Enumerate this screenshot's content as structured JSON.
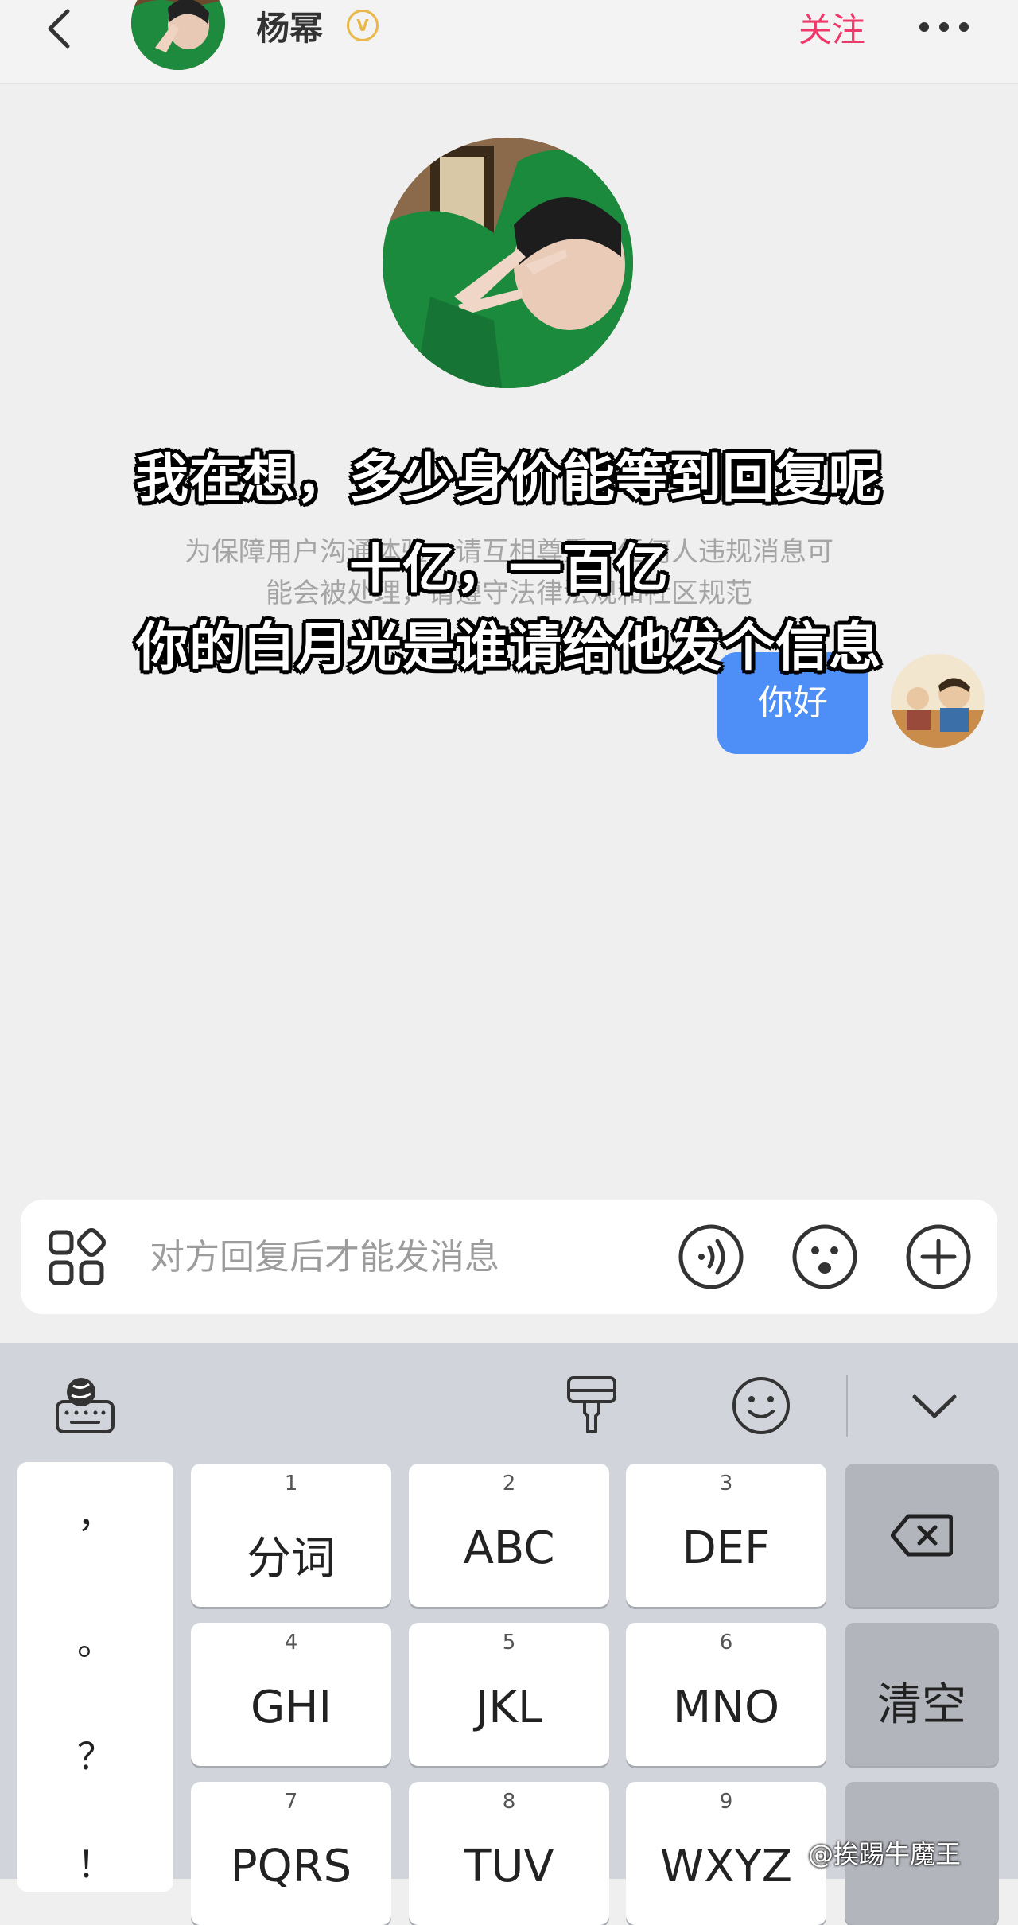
{
  "header": {
    "name": "杨幂",
    "verified_badge": "V",
    "follow_label": "关注",
    "icons": [
      "back-icon",
      "more-icon"
    ]
  },
  "chat": {
    "notice_line1": "为保障用户沟通体验，请互相尊重，任何人违规消息可",
    "notice_line2": "能会被处理，请遵守法律法规和社区规范",
    "my_message": "你好"
  },
  "caption": {
    "line1": "我在想，多少身价能等到回复呢",
    "line2": "十亿，一百亿",
    "line3": "你的白月光是谁请给他发个信息"
  },
  "input_bar": {
    "placeholder": "对方回复后才能发消息",
    "icons": [
      "apps-icon",
      "voice-icon",
      "emoji-icon",
      "plus-icon"
    ]
  },
  "keyboard": {
    "toolbar_icons": [
      "globe-keyboard-icon",
      "brush-icon",
      "smile-icon",
      "chevron-down-icon"
    ],
    "punctuation": [
      "，",
      "。",
      "？",
      "！"
    ],
    "keys": [
      {
        "num": "1",
        "label": "分词"
      },
      {
        "num": "2",
        "label": "ABC"
      },
      {
        "num": "3",
        "label": "DEF"
      },
      {
        "num": "4",
        "label": "GHI"
      },
      {
        "num": "5",
        "label": "JKL"
      },
      {
        "num": "6",
        "label": "MNO"
      },
      {
        "num": "7",
        "label": "PQRS"
      },
      {
        "num": "8",
        "label": "TUV"
      },
      {
        "num": "9",
        "label": "WXYZ"
      }
    ],
    "clear_label": "清空",
    "backspace_icon": "backspace-icon"
  },
  "watermark": "@挨踢牛魔王",
  "colors": {
    "follow": "#f0386a",
    "bubble": "#4d8ff6",
    "background": "#efefef",
    "keyboard_bg": "#d2d4db"
  }
}
